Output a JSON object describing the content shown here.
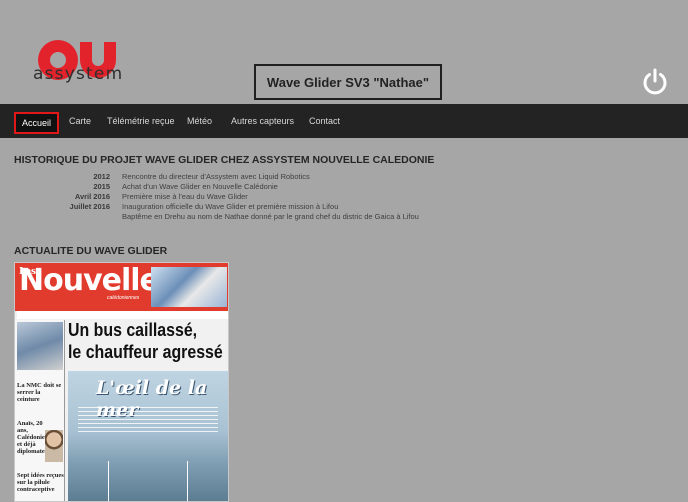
{
  "brand": {
    "logo_text": "assystem",
    "logo_icon": "assystem-logo-icon"
  },
  "header": {
    "project_title": "Wave Glider SV3 \"Nathae\"",
    "power_icon": "power-icon"
  },
  "nav": {
    "items": [
      {
        "label": "Accueil",
        "active": true
      },
      {
        "label": "Carte"
      },
      {
        "label": "Télémétrie reçue"
      },
      {
        "label": "Météo"
      },
      {
        "label": "Autres capteurs"
      },
      {
        "label": "Contact"
      }
    ]
  },
  "history": {
    "title": "HISTORIQUE DU PROJET WAVE GLIDER CHEZ ASSYSTEM NOUVELLE CALEDONIE",
    "rows": [
      {
        "date": "2012",
        "text": "Rencontre du directeur d'Assystem avec Liquid Robotics"
      },
      {
        "date": "2015",
        "text": "Achat d'un Wave Glider en Nouvelle Calédonie"
      },
      {
        "date": "Avril 2016",
        "text": "Première mise à l'eau du Wave Glider"
      },
      {
        "date": "Juillet 2016",
        "text": "Inauguration officielle du Wave Glider et première mission à Lifou"
      },
      {
        "date": "",
        "text": "Baptême en Drehu au nom de Nathae donné par le grand chef du distric de Gaica à Lifou"
      }
    ]
  },
  "news": {
    "title": "ACTUALITE DU WAVE GLIDER",
    "paper": {
      "masthead": "Nouvelles",
      "masthead_prefix": "Les",
      "masthead_sub": "calédoniennes",
      "headline_1": "Un bus caillassé,",
      "headline_2": "le chauffeur agressé",
      "hero_title": "L'œil de la mer",
      "side_1": "La NMC doit se serrer la ceinture",
      "side_2": "Anaïs, 20 ans, Calédonienne et déjà diplomate",
      "side_3": "Sept idées reçues sur la pilule contraceptive"
    }
  },
  "colors": {
    "background": "#a6a6a6",
    "nav_bg": "#232323",
    "active_border": "#e01818",
    "brand_red": "#e3232c"
  }
}
